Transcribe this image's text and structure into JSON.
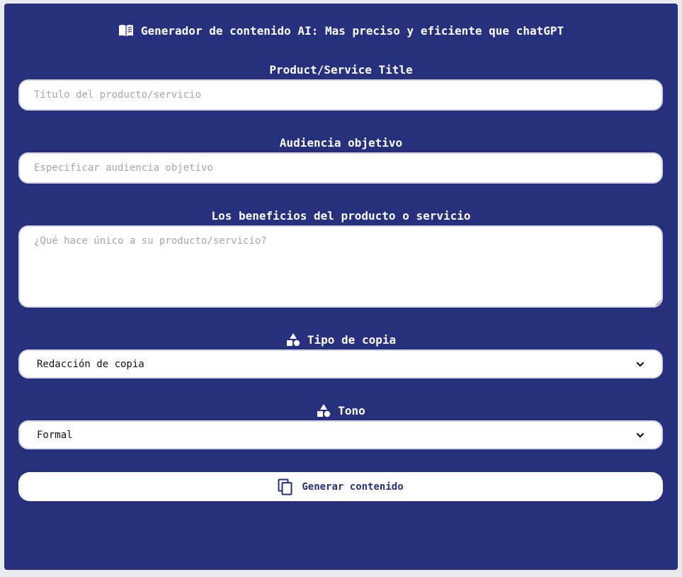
{
  "header": {
    "title": "Generador de contenido AI: Mas preciso y eficiente que chatGPT",
    "icon": "book-open-icon"
  },
  "form": {
    "product_title": {
      "label": "Product/Service Title",
      "value": "",
      "placeholder": "Título del producto/servicio"
    },
    "audience": {
      "label": "Audiencia objetivo",
      "value": "",
      "placeholder": "Especificar audiencia objetivo"
    },
    "benefits": {
      "label": "Los beneficios del producto o servicio",
      "value": "",
      "placeholder": "¿Qué hace único a su producto/servicio?"
    },
    "copy_type": {
      "label": "Tipo de copia",
      "icon": "shapes-icon",
      "selected": "Redacción de copia"
    },
    "tone": {
      "label": "Tono",
      "icon": "shapes-icon",
      "selected": "Formal"
    },
    "submit": {
      "label": "Generar contenido",
      "icon": "copy-icon"
    }
  },
  "colors": {
    "panel_background": "#26307c",
    "field_background": "#ffffff",
    "placeholder_text": "#a3a6ae"
  }
}
